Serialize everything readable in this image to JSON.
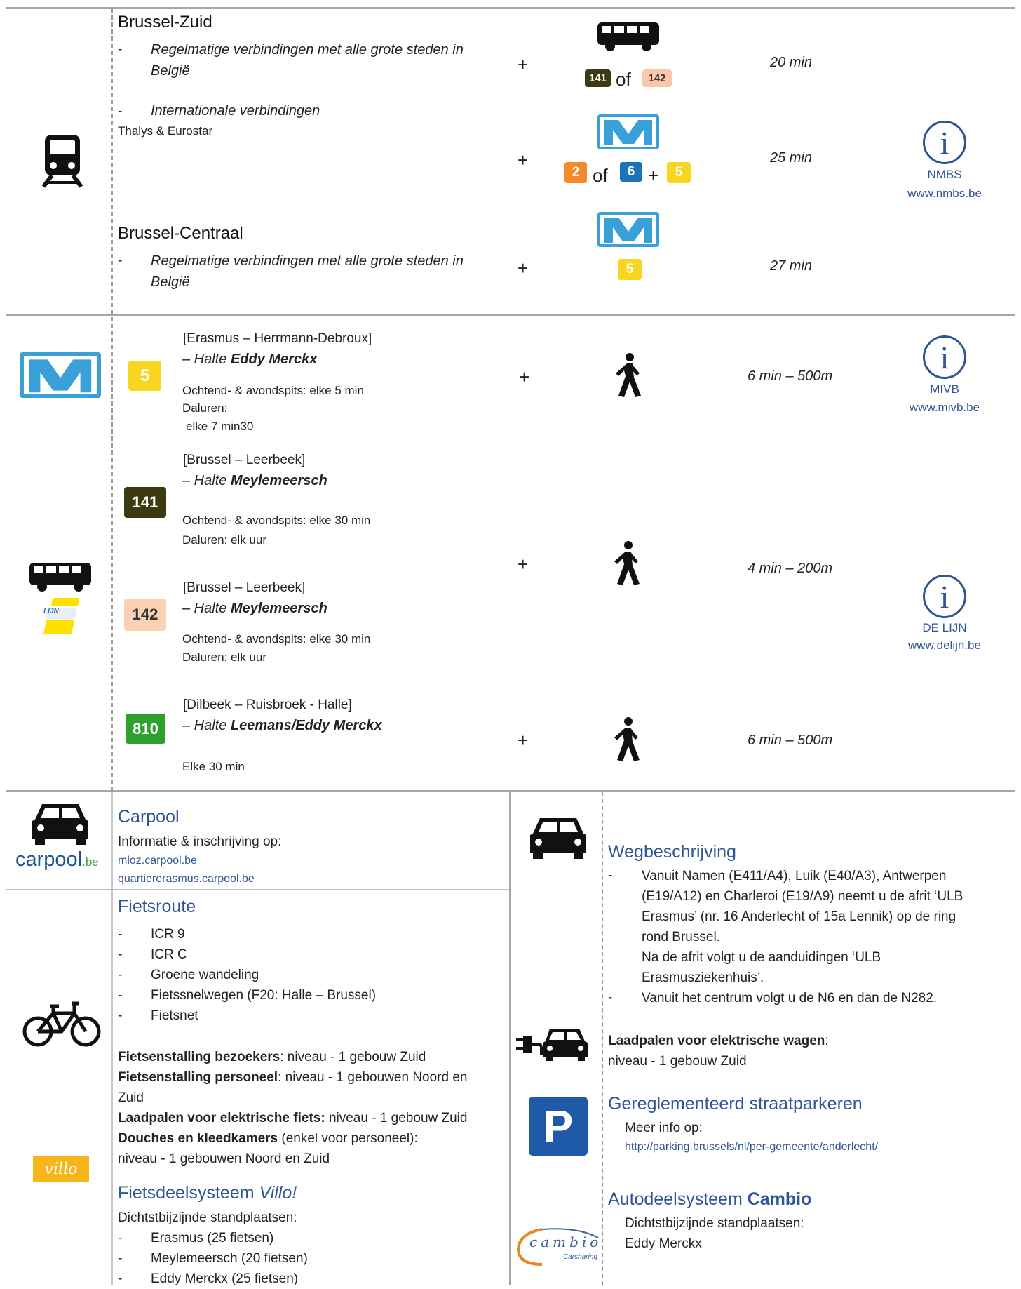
{
  "train": {
    "zuid_title": "Brussel-Zuid",
    "zuid_line1": "Regelmatige verbindingen met alle grote steden in België",
    "zuid_line2": "Internationale verbindingen",
    "zuid_line3": "Thalys & Eurostar",
    "bus_141": "141",
    "bus_of": "of",
    "bus_142": "142",
    "time1": "20 min",
    "m2": "2",
    "m_of": "of",
    "m6": "6",
    "m_plus": "+",
    "m5": "5",
    "time2": "25 min",
    "centraal_title": "Brussel-Centraal",
    "centraal_line1": "Regelmatige verbindingen met alle grote steden in België",
    "c5": "5",
    "time3": "27 min",
    "info_name": "NMBS",
    "info_url": "www.nmbs.be",
    "plus": "+"
  },
  "metro": {
    "badge": "5",
    "route": "[Erasmus – Herrmann-Debroux]",
    "halte_prefix": "– Halte ",
    "halte": "Eddy Merckx",
    "freq1": "Ochtend- & avondspits: elke 5 min",
    "freq2": "Daluren:",
    "freq3": "elke 7 min30",
    "time": "6 min – 500m",
    "info_name": "MIVB",
    "info_url": "www.mivb.be"
  },
  "bus": {
    "b141": "141",
    "r141": "[Brussel – Leerbeek]",
    "halte_prefix": "– Halte ",
    "h141": "Meylemeersch",
    "f141a": "Ochtend- & avondspits: elke 30 min",
    "f141b": "Daluren: elk uur",
    "b142": "142",
    "r142": "[Brussel – Leerbeek]",
    "h142": "Meylemeersch",
    "f142a": "Ochtend- & avondspits: elke 30 min",
    "f142b": "Daluren: elk uur",
    "time1": "4 min – 200m",
    "b810": "810",
    "r810": "[Dilbeek – Ruisbroek - Halle]",
    "h810": "Leemans/Eddy Merckx",
    "f810": "Elke 30 min",
    "time2": "6 min – 500m",
    "info_name": "DE LIJN",
    "info_url": "www.delijn.be",
    "lijn_logo": "LIJN"
  },
  "carpool": {
    "title": "Carpool",
    "text": "Informatie & inschrijving op:",
    "link1": "mloz.carpool.be",
    "link2": "quartiererasmus.carpool.be",
    "logo_main": "carpool",
    "logo_suffix": ".be"
  },
  "bike": {
    "title": "Fietsroute",
    "items": [
      "ICR 9",
      "ICR C",
      "Groene wandeling",
      "Fietssnelwegen (F20: Halle – Brussel)",
      "Fietsnet"
    ],
    "p1_bold": "Fietsenstalling bezoekers",
    "p1_rest": ": niveau - 1 gebouw Zuid",
    "p2_bold": "Fietsenstalling personeel",
    "p2_rest": ": niveau - 1 gebouwen Noord en",
    "p2_rest2": "Zuid",
    "p3_bold": "Laadpalen voor elektrische fiets:",
    "p3_rest": " niveau - 1 gebouw Zuid",
    "p4_bold": "Douches en kleedkamers",
    "p4_rest": " (enkel voor personeel):",
    "p4_rest2": "niveau - 1 gebouwen Noord en Zuid",
    "villo_title": "Fietsdeelsysteem ",
    "villo_title_it": "Villo!",
    "villo_text": "Dichtstbijzijnde standplaatsen:",
    "villo_items": [
      "Erasmus (25 fietsen)",
      "Meylemeersch (20 fietsen)",
      "Eddy Merckx (25 fietsen)"
    ],
    "villo_logo": "villo"
  },
  "car": {
    "title": "Wegbeschrijving",
    "d1": "Vanuit Namen (E411/A4), Luik (E40/A3), Antwerpen",
    "d2": "(E19/A12) en Charleroi (E19/A9) neemt u de afrit ‘ULB",
    "d3": "Erasmus’ (nr. 16 Anderlecht of 15a Lennik) op de ring",
    "d4": "rond Brussel.",
    "d5": "Na de afrit volgt u de aanduidingen ‘ULB",
    "d6": "Erasmusziekenhuis’.",
    "d7": "Vanuit het centrum volgt u de N6 en dan de N282.",
    "ev_bold": "Laadpalen voor elektrische wagen",
    "ev_colon": ":",
    "ev_text": "niveau - 1 gebouw Zuid",
    "park_title": "Gereglementeerd straatparkeren",
    "park_text": "Meer info op:",
    "park_link": "http://parking.brussels/nl/per-gemeente/anderlecht/",
    "park_sign": "P",
    "cambio_title": "Autodeelsysteem ",
    "cambio_bold": "Cambio",
    "cambio_text": "Dichtstbijzijnde standplaatsen:",
    "cambio_place": "Eddy Merckx",
    "cambio_logo": "cambio",
    "cambio_sub": "Carsharing"
  },
  "dash": "-"
}
